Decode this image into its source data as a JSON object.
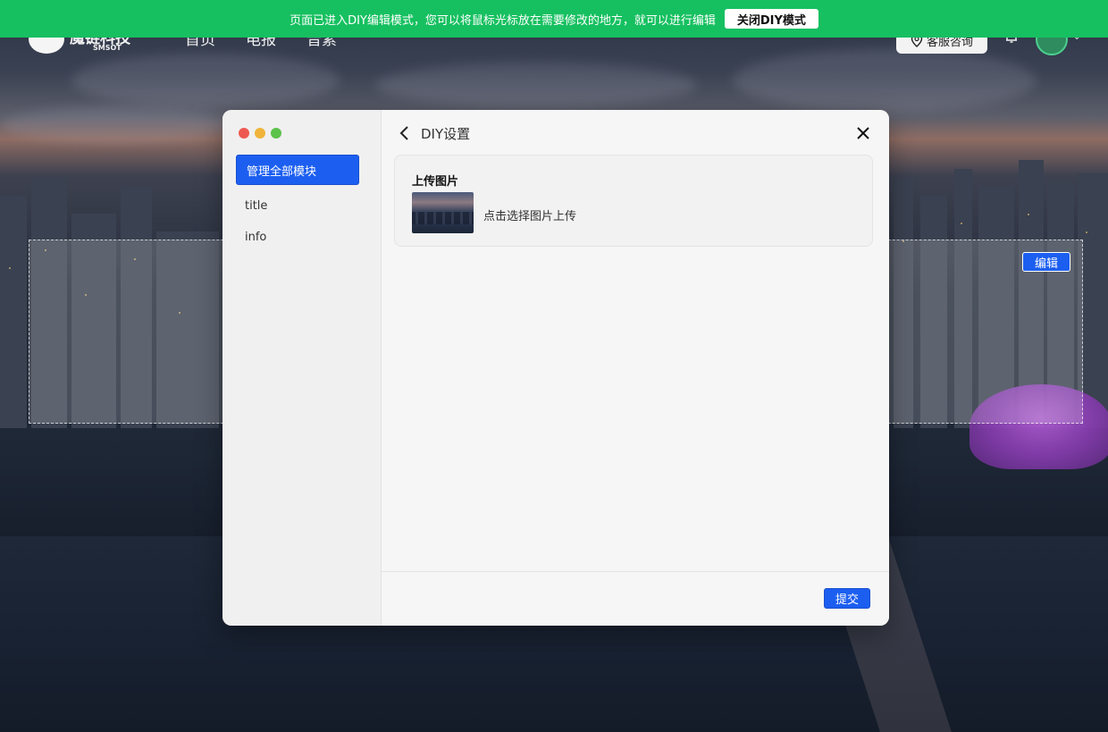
{
  "diy_bar": {
    "message": "页面已进入DIY编辑模式，您可以将鼠标光标放在需要修改的地方，就可以进行编辑",
    "close_label": "关闭DIY模式",
    "color": "#16c060"
  },
  "site_header": {
    "logo_text": "魔链科技",
    "logo_sub": "SMSOT",
    "nav": [
      "首页",
      "电报",
      "音素"
    ],
    "consult_label": "客服咨询",
    "bell_icon": "bell-icon",
    "avatar_icon": "avatar"
  },
  "edit_region": {
    "edit_label": "编辑"
  },
  "modal": {
    "sidebar": {
      "active_item": "管理全部模块",
      "items": [
        "title",
        "info"
      ]
    },
    "header": {
      "title": "DIY设置",
      "back_icon": "chevron-left-icon",
      "close_icon": "close-icon"
    },
    "upload": {
      "title": "上传图片",
      "hint": "点击选择图片上传"
    },
    "submit_label": "提交",
    "accent": "#1c5ff0"
  }
}
